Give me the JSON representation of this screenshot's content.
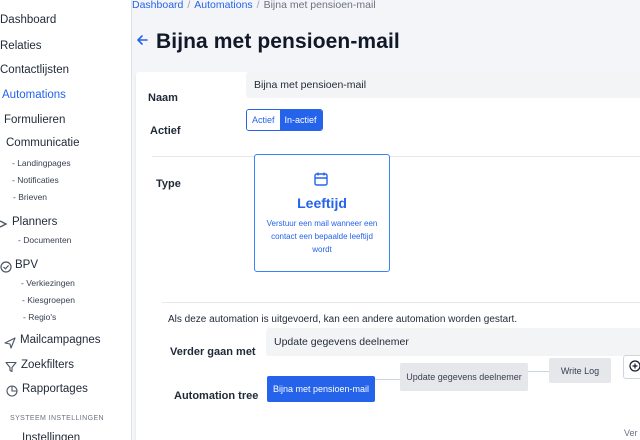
{
  "sidebar": {
    "items": [
      {
        "label": "Dashboard"
      },
      {
        "label": "Relaties"
      },
      {
        "label": "Contactlijsten"
      },
      {
        "label": "Automations",
        "active": true
      },
      {
        "label": "Formulieren"
      },
      {
        "label": "Communicatie"
      },
      {
        "label": "Landingpages"
      },
      {
        "label": "Notificaties"
      },
      {
        "label": "Brieven"
      },
      {
        "label": "Planners"
      },
      {
        "label": "Documenten"
      },
      {
        "label": "BPV"
      },
      {
        "label": "Verkiezingen"
      },
      {
        "label": "Kiesgroepen"
      },
      {
        "label": "Regio's"
      },
      {
        "label": "Mailcampagnes"
      },
      {
        "label": "Zoekfilters"
      },
      {
        "label": "Rapportages"
      }
    ],
    "section_label": "SYSTEEM INSTELLINGEN",
    "cut_item": "Instellingen"
  },
  "breadcrumb": {
    "items": [
      "Dashboard",
      "Automations",
      "Bijna met pensioen-mail"
    ],
    "separator": "/"
  },
  "page": {
    "title": "Bijna met pensioen-mail",
    "back_icon": "arrow-left-icon"
  },
  "form": {
    "naam_label": "Naam",
    "naam_value": "Bijna met pensioen-mail",
    "actief_label": "Actief",
    "actief_options": [
      "Actief",
      "In-actief"
    ],
    "actief_selected": "In-actief",
    "type_label": "Type",
    "type_card": {
      "icon": "calendar-icon",
      "title": "Leeftijd",
      "description": "Verstuur een mail wanneer een contact een bepaalde leeftijd wordt"
    },
    "info_text": "Als deze automation is uitgevoerd, kan een andere automation worden gestart.",
    "verder_label": "Verder gaan met",
    "verder_value": "Update gegevens deelnemer",
    "tree_label": "Automation tree",
    "tree_nodes": [
      "Bijna met pensioen-mail",
      "Update gegevens deelnemer",
      "Write Log"
    ],
    "add_icon": "plus-circle-icon",
    "cut_bottom_text": "Ver"
  },
  "colors": {
    "accent": "#2563eb",
    "sidebar_bg": "#ffffff",
    "main_bg": "#f3f5f8"
  }
}
